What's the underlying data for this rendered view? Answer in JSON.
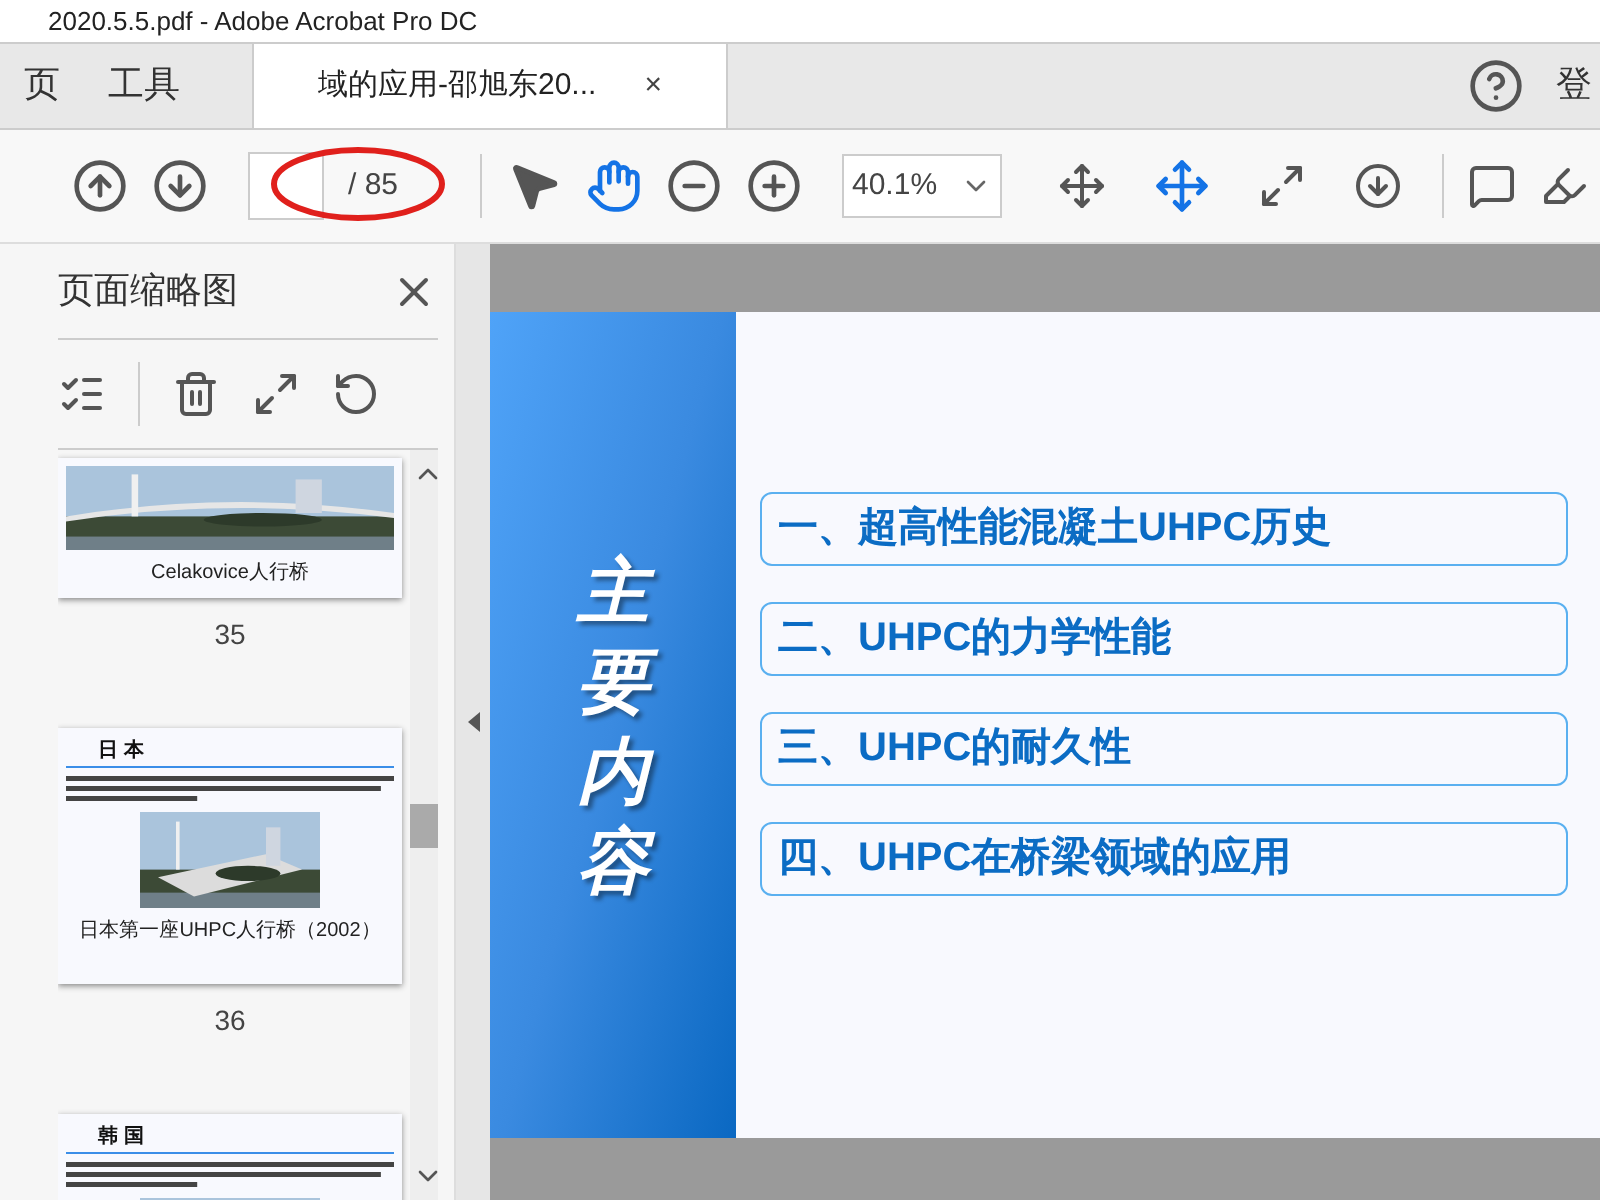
{
  "window": {
    "title": "2020.5.5.pdf - Adobe Acrobat Pro DC"
  },
  "tabs": [
    {
      "label": "页",
      "selected": false
    },
    {
      "label": "工具",
      "selected": false
    },
    {
      "label": "域的应用-邵旭东20...",
      "selected": true,
      "close": "×"
    }
  ],
  "account": {
    "label": "登"
  },
  "toolbar": {
    "page_total": "/ 85",
    "zoom": "40.1%",
    "hand_selected": true
  },
  "sidebar": {
    "title": "页面缩略图",
    "thumbnails": [
      {
        "caption": "Celakovice人行桥",
        "page": "35",
        "selected": false
      },
      {
        "heading": "日 本",
        "caption": "日本第一座UHPC人行桥（2002）",
        "page": "36",
        "selected": false
      },
      {
        "heading": "韩 国",
        "selected": false
      }
    ]
  },
  "slide": {
    "title": "主要内容",
    "items": [
      "一、超高性能混凝土UHPC历史",
      "二、UHPC的力学性能",
      "三、UHPC的耐久性",
      "四、UHPC在桥梁领域的应用"
    ]
  }
}
